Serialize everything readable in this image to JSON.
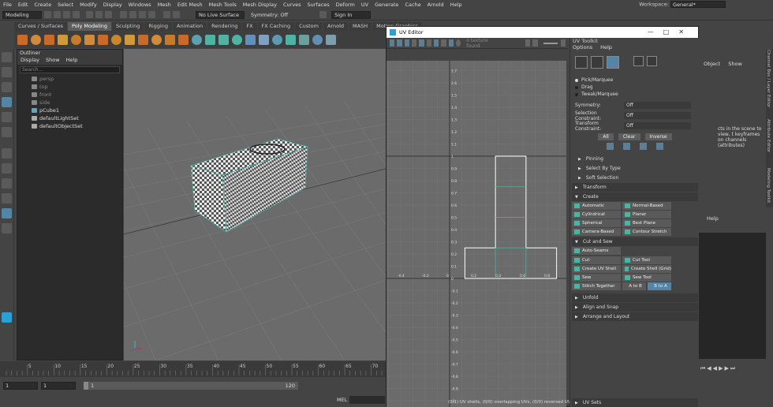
{
  "menubar": {
    "items": [
      "File",
      "Edit",
      "Create",
      "Select",
      "Modify",
      "Display",
      "Windows",
      "Mesh",
      "Edit Mesh",
      "Mesh Tools",
      "Mesh Display",
      "Curves",
      "Surfaces",
      "Deform",
      "UV",
      "Generate",
      "Cache",
      "Arnold",
      "Help"
    ],
    "workspace_label": "Workspace:",
    "workspace_value": "General*"
  },
  "statusline": {
    "mode": "Modeling",
    "live_surface": "No Live Surface",
    "symmetry": "Symmetry: Off",
    "signin": "Sign In"
  },
  "shelf": {
    "tabs": [
      "Curves / Surfaces",
      "Poly Modeling",
      "Sculpting",
      "Rigging",
      "Animation",
      "Rendering",
      "FX",
      "FX Caching",
      "Custom",
      "Arnold",
      "MASH",
      "Motion Graphics"
    ],
    "active_tab": "Poly Modeling"
  },
  "outliner": {
    "title": "Outliner",
    "menus": [
      "Display",
      "Show",
      "Help"
    ],
    "search_placeholder": "Search...",
    "items": [
      {
        "label": "persp",
        "dim": true
      },
      {
        "label": "top",
        "dim": true
      },
      {
        "label": "front",
        "dim": true
      },
      {
        "label": "side",
        "dim": true
      },
      {
        "label": "pCube1",
        "dim": false
      },
      {
        "label": "defaultLightSet",
        "dim": false
      },
      {
        "label": "defaultObjectSet",
        "dim": false
      }
    ]
  },
  "timeline": {
    "ticks": [
      "5",
      "10",
      "15",
      "20",
      "25",
      "30",
      "35",
      "40",
      "45",
      "50",
      "55",
      "60",
      "65",
      "70"
    ],
    "range_start": "1",
    "range_start2": "1",
    "range_inner": "1",
    "range_end": "120",
    "mel_label": "MEL"
  },
  "uv_editor": {
    "title": "UV Editor",
    "menus": [
      "Edit",
      "View",
      "Select",
      "Modify",
      "Tool",
      "Image",
      "Textures",
      "UV Sets",
      "Help"
    ],
    "texture_field": "o texture found",
    "status_text": "(0/1) UV shells, (0/0) overlapping UVs, (0/0) reversed UVs",
    "y_ticks": [
      "1.9",
      "1.8",
      "1.7",
      "1.6",
      "1.5",
      "1.4",
      "1.3",
      "1.2",
      "1.1",
      "1",
      "0.9",
      "0.8",
      "0.7",
      "0.6",
      "0.5",
      "0.4",
      "0.3",
      "0.2",
      "0.1",
      "0",
      "-0.1",
      "-0.2",
      "-0.3",
      "-0.4",
      "-0.5",
      "-0.6",
      "-0.7",
      "-0.8",
      "-0.9",
      "-1"
    ],
    "x_ticks": [
      "-0.8",
      "-0.6",
      "-0.4",
      "-0.2",
      "0",
      "0.2",
      "0.4",
      "0.6",
      "0.8",
      "1",
      "1.2",
      "1.4"
    ]
  },
  "uv_toolkit": {
    "header": "UV Toolkit",
    "menus": [
      "Options",
      "Help"
    ],
    "modes": [
      "Pick/Marquee",
      "Drag",
      "Tweak/Marquee"
    ],
    "active_mode": "Pick/Marquee",
    "symmetry_label": "Symmetry:",
    "symmetry_value": "Off",
    "selection_constraint_label": "Selection Constraint:",
    "selection_constraint_value": "Off",
    "transform_constraint_label": "Transform Constraint:",
    "transform_constraint_value": "Off",
    "buttons": [
      "All",
      "Clear",
      "Inverse"
    ],
    "sections_top": [
      "Pinning",
      "Select By Type",
      "Soft Selection",
      "Transform"
    ],
    "create_label": "Create",
    "create_buttons": [
      "Automatic",
      "Normal-Based",
      "Cylindrical",
      "Planar",
      "Spherical",
      "Best Plane",
      "Camera-Based",
      "Contour Stretch"
    ],
    "cutsew_label": "Cut and Sew",
    "auto_seams": "Auto-Seams",
    "cut_buttons": [
      "Cut",
      "Cut Tool",
      "Create UV Shell",
      "Create Shell (Grid)",
      "Sew",
      "Sew Tool",
      "Stitch Together"
    ],
    "a_to_b": "A to B",
    "b_to_a": "B to A",
    "sections_bottom": [
      "Unfold",
      "Align and Snap",
      "Arrange and Layout"
    ],
    "uvsets": "UV Sets"
  },
  "right_panel": {
    "object": "Object",
    "show": "Show",
    "message": "cts in the scene to view, t keyframes on channels (attributes)",
    "help": "Help",
    "vertical_tabs": [
      "Channel Box / Layer Editor",
      "Attribute Editor",
      "Modeling Toolkit"
    ]
  },
  "colors": {
    "viewport_bg": "#6b6b6b",
    "uv_accent": "#4fb3a3",
    "selection_blue": "#5285a6"
  }
}
